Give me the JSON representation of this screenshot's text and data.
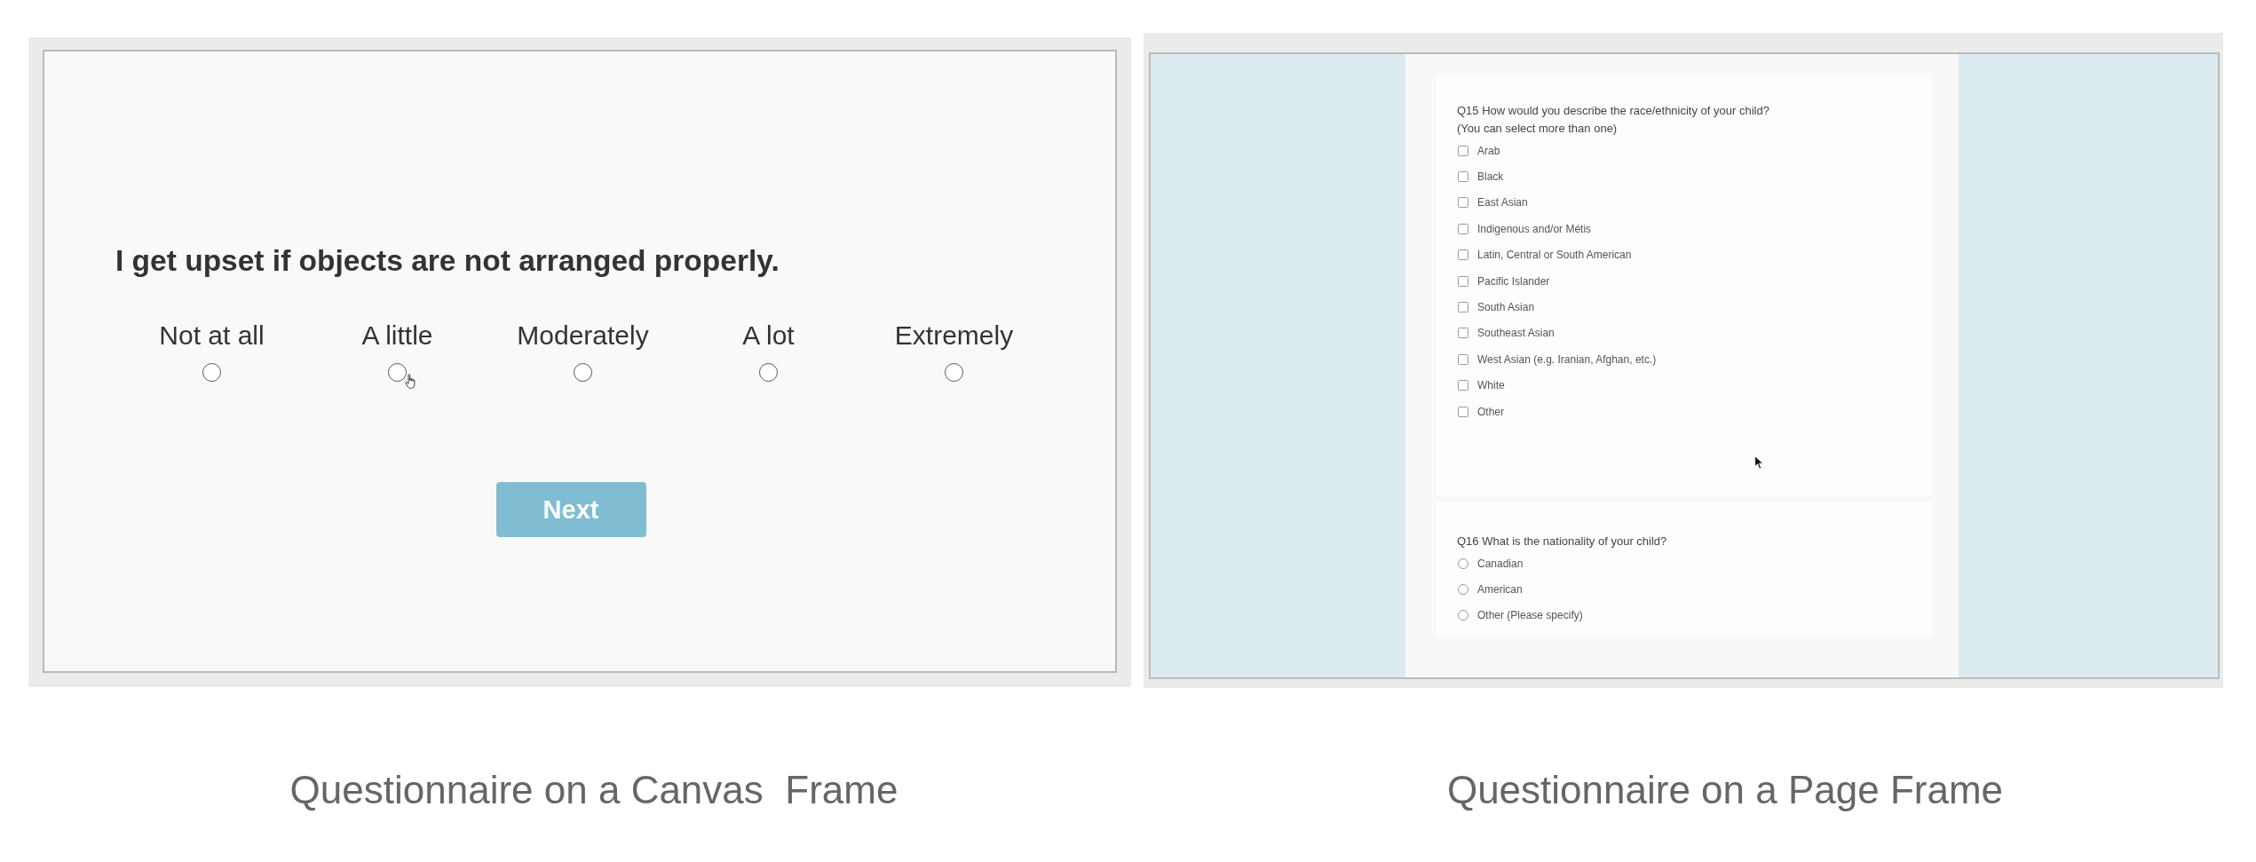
{
  "canvas_frame": {
    "question": "I get upset if objects are not arranged properly.",
    "options": [
      {
        "label": "Not at all",
        "selected": false,
        "hovered": false
      },
      {
        "label": "A little",
        "selected": false,
        "hovered": true
      },
      {
        "label": "Moderately",
        "selected": false,
        "hovered": false
      },
      {
        "label": "A lot",
        "selected": false,
        "hovered": false
      },
      {
        "label": "Extremely",
        "selected": false,
        "hovered": false
      }
    ],
    "button": "Next",
    "caption": "Questionnaire on a Canvas  Frame"
  },
  "page_frame": {
    "questions": [
      {
        "kind": "checkbox",
        "title": "Q15 How would you describe the race/ethnicity of your child?",
        "note": "(You can select more than one)",
        "options": [
          {
            "label": "Arab",
            "checked": false
          },
          {
            "label": "Black",
            "checked": false
          },
          {
            "label": "East Asian",
            "checked": false
          },
          {
            "label": "Indigenous and/or Métis",
            "checked": false
          },
          {
            "label": "Latin, Central or South American",
            "checked": false
          },
          {
            "label": "Pacific Islander",
            "checked": false
          },
          {
            "label": "South Asian",
            "checked": false
          },
          {
            "label": "Southeast Asian",
            "checked": false
          },
          {
            "label": "West Asian (e.g. Iranian, Afghan, etc.)",
            "checked": false
          },
          {
            "label": "White",
            "checked": false
          },
          {
            "label": "Other",
            "checked": false
          }
        ]
      },
      {
        "kind": "radio",
        "title": "Q16 What is the nationality of your child?",
        "options": [
          {
            "label": "Canadian",
            "selected": false
          },
          {
            "label": "American",
            "selected": false
          },
          {
            "label": "Other (Please specify)",
            "selected": false
          }
        ]
      }
    ],
    "caption": "Questionnaire on a Page Frame"
  }
}
